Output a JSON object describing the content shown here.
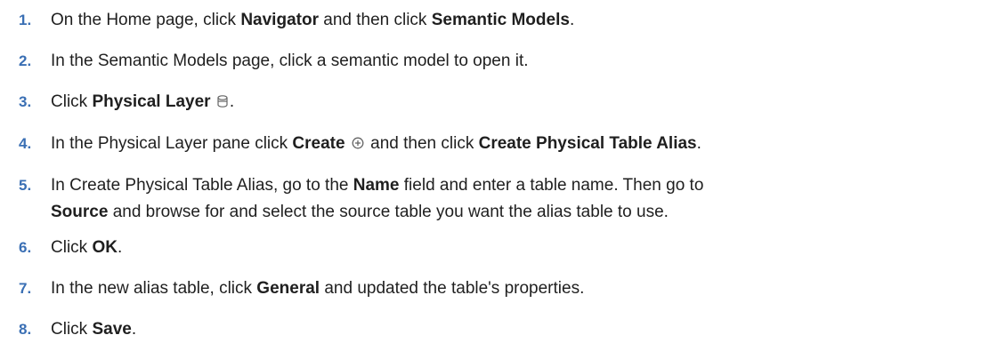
{
  "steps": [
    {
      "num": "1.",
      "t1": "On the Home page, click ",
      "b1": "Navigator",
      "t2": " and then click ",
      "b2": "Semantic Models",
      "t3": "."
    },
    {
      "num": "2.",
      "t1": "In the Semantic Models page, click a semantic model to open it."
    },
    {
      "num": "3.",
      "t1": "Click ",
      "b1": "Physical Layer",
      "icon": "database-icon",
      "t2": "."
    },
    {
      "num": "4.",
      "t1": "In the Physical Layer pane click ",
      "b1": "Create",
      "icon": "plus-circle-icon",
      "t2": " and then click ",
      "b2": "Create Physical Table Alias",
      "t3": "."
    },
    {
      "num": "5.",
      "t1": "In Create Physical Table Alias, go to the ",
      "b1": "Name",
      "t2": " field and enter a table name. Then go to",
      "b2": "Source",
      "t3": " and browse for and select the source table you want the alias table to use."
    },
    {
      "num": "6.",
      "t1": "Click ",
      "b1": "OK",
      "t2": "."
    },
    {
      "num": "7.",
      "t1": "In the new alias table, click ",
      "b1": "General",
      "t2": " and updated the table's properties."
    },
    {
      "num": "8.",
      "t1": "Click ",
      "b1": "Save",
      "t2": "."
    }
  ]
}
